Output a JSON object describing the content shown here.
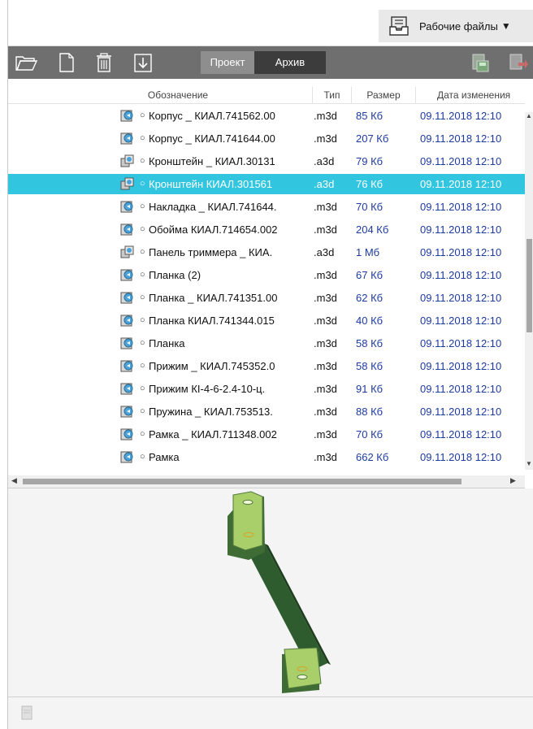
{
  "header": {
    "workfiles_label": "Рабочие файлы",
    "workfiles_arrow": "▼"
  },
  "toolbar": {
    "tab_project": "Проект",
    "tab_archive": "Архив"
  },
  "columns": {
    "name": "Обозначение",
    "type": "Тип",
    "size": "Размер",
    "date": "Дата изменения"
  },
  "rows": [
    {
      "icon": "part-icon",
      "bullet": "○",
      "name": "Корпус _ КИАЛ.741562.00",
      "type": ".m3d",
      "size": "85 Кб",
      "date": "09.11.2018 12:10",
      "selected": false
    },
    {
      "icon": "part-icon",
      "bullet": "○",
      "name": "Корпус _ КИАЛ.741644.00",
      "type": ".m3d",
      "size": "207 Кб",
      "date": "09.11.2018 12:10",
      "selected": false
    },
    {
      "icon": "assembly-icon",
      "bullet": "○",
      "name": "Кронштейн _ КИАЛ.30131",
      "type": ".a3d",
      "size": "79 Кб",
      "date": "09.11.2018 12:10",
      "selected": false
    },
    {
      "icon": "assembly-icon",
      "bullet": "○",
      "name": "Кронштейн КИАЛ.301561",
      "type": ".a3d",
      "size": "76 Кб",
      "date": "09.11.2018 12:10",
      "selected": true
    },
    {
      "icon": "part-icon",
      "bullet": "○",
      "name": "Накладка _ КИАЛ.741644.",
      "type": ".m3d",
      "size": "70 Кб",
      "date": "09.11.2018 12:10",
      "selected": false
    },
    {
      "icon": "part-icon",
      "bullet": "○",
      "name": "Обойма КИАЛ.714654.002",
      "type": ".m3d",
      "size": "204 Кб",
      "date": "09.11.2018 12:10",
      "selected": false
    },
    {
      "icon": "assembly-icon",
      "bullet": "○",
      "name": "Панель триммера _ КИА.",
      "type": ".a3d",
      "size": "1 Мб",
      "date": "09.11.2018 12:10",
      "selected": false
    },
    {
      "icon": "part-icon",
      "bullet": "○",
      "name": "Планка (2)",
      "type": ".m3d",
      "size": "67 Кб",
      "date": "09.11.2018 12:10",
      "selected": false
    },
    {
      "icon": "part-icon",
      "bullet": "○",
      "name": "Планка _ КИАЛ.741351.00",
      "type": ".m3d",
      "size": "62 Кб",
      "date": "09.11.2018 12:10",
      "selected": false
    },
    {
      "icon": "part-icon",
      "bullet": "○",
      "name": "Планка КИАЛ.741344.015",
      "type": ".m3d",
      "size": "40 Кб",
      "date": "09.11.2018 12:10",
      "selected": false
    },
    {
      "icon": "part-icon",
      "bullet": "○",
      "name": "Планка",
      "type": ".m3d",
      "size": "58 Кб",
      "date": "09.11.2018 12:10",
      "selected": false
    },
    {
      "icon": "part-icon",
      "bullet": "○",
      "name": "Прижим _ КИАЛ.745352.0",
      "type": ".m3d",
      "size": "58 Кб",
      "date": "09.11.2018 12:10",
      "selected": false
    },
    {
      "icon": "part-icon",
      "bullet": "○",
      "name": "Прижим КI-4-6-2.4-10-ц.",
      "type": ".m3d",
      "size": "91 Кб",
      "date": "09.11.2018 12:10",
      "selected": false
    },
    {
      "icon": "part-icon",
      "bullet": "○",
      "name": "Пружина _ КИАЛ.753513.",
      "type": ".m3d",
      "size": "88 Кб",
      "date": "09.11.2018 12:10",
      "selected": false
    },
    {
      "icon": "part-icon",
      "bullet": "○",
      "name": "Рамка _ КИАЛ.711348.002",
      "type": ".m3d",
      "size": "70 Кб",
      "date": "09.11.2018 12:10",
      "selected": false
    },
    {
      "icon": "part-icon",
      "bullet": "○",
      "name": "Рамка",
      "type": ".m3d",
      "size": "662 Кб",
      "date": "09.11.2018 12:10",
      "selected": false
    }
  ],
  "colors": {
    "selection": "#32c5e0",
    "toolbar": "#6f6f6f",
    "link_blue": "#1d3aa0",
    "part_green": "#a9cf6a",
    "part_dark": "#4f7a3c"
  }
}
